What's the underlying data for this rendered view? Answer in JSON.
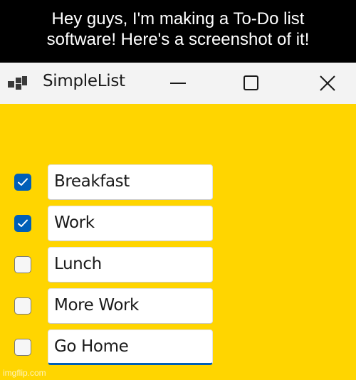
{
  "caption": {
    "line1": "Hey guys, I'm making a To-Do list",
    "line2": "software! Here's a screenshot of it!"
  },
  "window": {
    "title": "SimpleList",
    "app_icon": "app-squares-icon",
    "controls": {
      "minimize_icon": "minimize-icon",
      "maximize_icon": "maximize-icon",
      "close_icon": "close-icon"
    },
    "background_color": "#ffd500"
  },
  "tasks": [
    {
      "label": "Breakfast",
      "checked": true
    },
    {
      "label": "Work",
      "checked": true
    },
    {
      "label": "Lunch",
      "checked": false
    },
    {
      "label": "More Work",
      "checked": false
    },
    {
      "label": "Go Home",
      "checked": false,
      "focused": true
    }
  ],
  "accent_color": "#005fb8",
  "watermark": "imgflip.com"
}
